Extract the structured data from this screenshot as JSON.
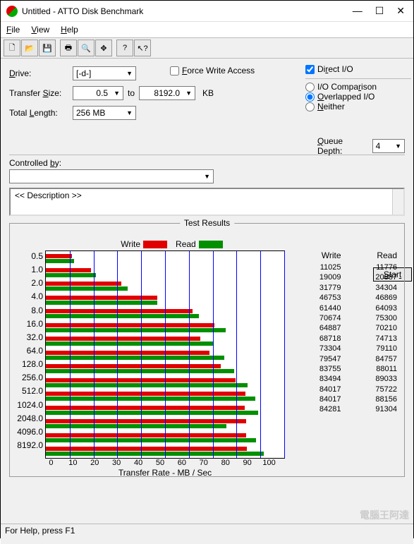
{
  "window": {
    "title": "Untitled - ATTO Disk Benchmark"
  },
  "menu": {
    "file": "File",
    "view": "View",
    "help": "Help"
  },
  "labels": {
    "drive": "Drive:",
    "transfer": "Transfer Size:",
    "to": "to",
    "kb": "KB",
    "total": "Total Length:",
    "force": "Force Write Access",
    "direct": "Direct I/O",
    "iocomp": "I/O Comparison",
    "overlap": "Overlapped I/O",
    "neither": "Neither",
    "queue": "Queue Depth:",
    "controlled": "Controlled by:",
    "start": "Start",
    "desc": "<< Description >>",
    "results": "Test Results",
    "write": "Write",
    "read": "Read",
    "xtitle": "Transfer Rate - MB / Sec",
    "status": "For Help, press F1"
  },
  "values": {
    "drive": "[-d-]",
    "tsFrom": "0.5",
    "tsTo": "8192.0",
    "length": "256 MB",
    "queue": "4",
    "controlled": ""
  },
  "options": {
    "force": false,
    "direct": true,
    "mode": "overlap"
  },
  "chart_data": {
    "type": "bar",
    "title": "Test Results",
    "xlabel": "Transfer Rate - MB / Sec",
    "ylabel": "",
    "xlim": [
      0,
      100
    ],
    "xticks": [
      0,
      10,
      20,
      30,
      40,
      50,
      60,
      70,
      80,
      90,
      100
    ],
    "categories": [
      "0.5",
      "1.0",
      "2.0",
      "4.0",
      "8.0",
      "16.0",
      "32.0",
      "64.0",
      "128.0",
      "256.0",
      "512.0",
      "1024.0",
      "2048.0",
      "4096.0",
      "8192.0"
    ],
    "series": [
      {
        "name": "Write",
        "color": "#e00000",
        "values": [
          11025,
          19009,
          31779,
          46753,
          61440,
          70674,
          64887,
          68718,
          73304,
          79547,
          83755,
          83494,
          84017,
          84017,
          84281
        ]
      },
      {
        "name": "Read",
        "color": "#009000",
        "values": [
          11776,
          20887,
          34304,
          46869,
          64093,
          75300,
          70210,
          74713,
          79110,
          84757,
          88011,
          89033,
          75722,
          88156,
          91304
        ]
      }
    ],
    "display_max": 100000
  },
  "watermark": "電腦王阿達"
}
